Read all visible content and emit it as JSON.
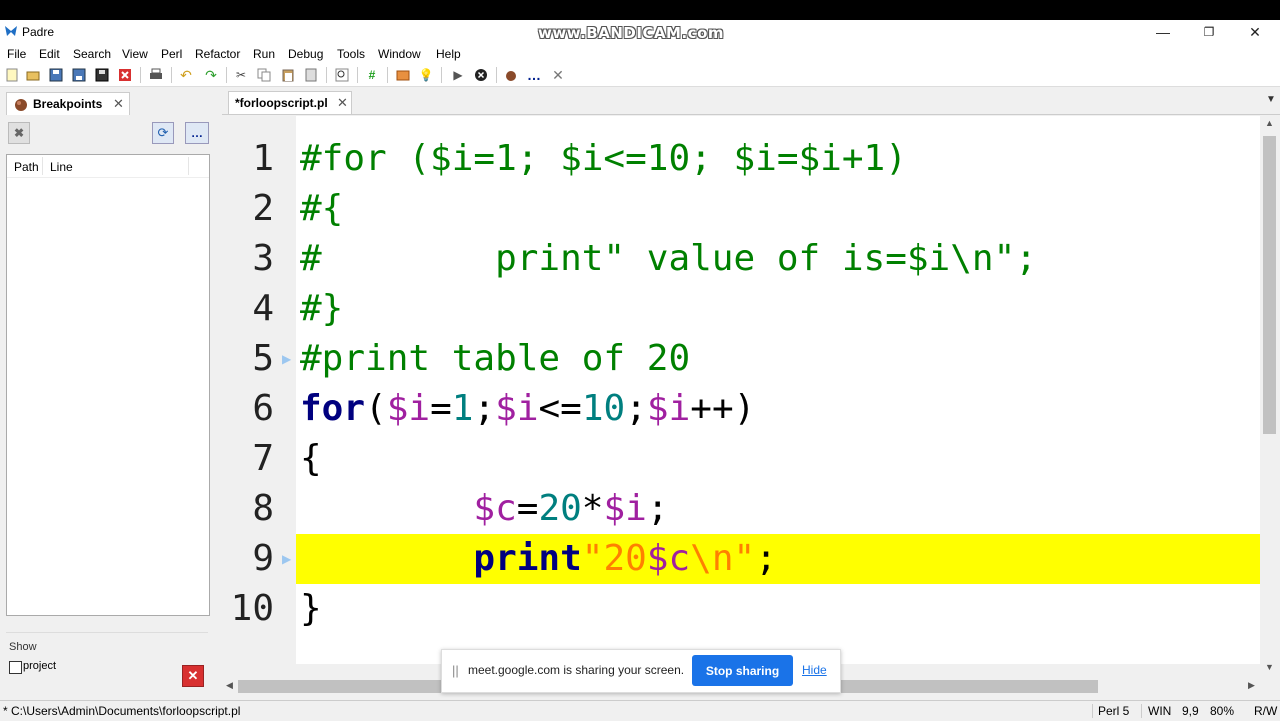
{
  "titlebar": {
    "title": "Padre",
    "minimize": "—",
    "restore": "❐",
    "close": "✕"
  },
  "watermark": "www.BANDICAM.com",
  "menu": [
    "File",
    "Edit",
    "Search",
    "View",
    "Perl",
    "Refactor",
    "Run",
    "Debug",
    "Tools",
    "Window",
    "Help"
  ],
  "left_panel": {
    "tab_label": "Breakpoints",
    "tab_close": "✕",
    "columns": [
      "Path",
      "Line"
    ],
    "show_label": "Show",
    "project_label": "project"
  },
  "editor": {
    "tab_label": "*forloopscript.pl",
    "tab_close": "✕",
    "line_numbers": [
      "1",
      "2",
      "3",
      "4",
      "5",
      "6",
      "7",
      "8",
      "9",
      "10"
    ],
    "lines": {
      "l1": "#for ($i=1; $i<=10; $i=$i+1)",
      "l2": "#{",
      "l3": "#        print\" value of is=$i\\n\";",
      "l4": "#}",
      "l5": "#print table of 20",
      "l6_for": "for",
      "l6_p1": "(",
      "l6_v1": "$i",
      "l6_eq": "=",
      "l6_n1": "1",
      "l6_sc1": ";",
      "l6_v2": "$i",
      "l6_le": "<=",
      "l6_n2": "10",
      "l6_sc2": ";",
      "l6_v3": "$i",
      "l6_inc": "++)",
      "l7": "{",
      "l8_ind": "        ",
      "l8_v1": "$c",
      "l8_eq": "=",
      "l8_n": "20",
      "l8_mul": "*",
      "l8_v2": "$i",
      "l8_sc": ";",
      "l9_ind": "        ",
      "l9_kw": "print",
      "l9_q1": "\"20",
      "l9_v": "$c",
      "l9_esc": "\\n",
      "l9_q2": "\"",
      "l9_sc": ";",
      "l10": "}"
    },
    "highlight_color": "#ffff00"
  },
  "share_bar": {
    "grip": "||",
    "message": "meet.google.com is sharing your screen.",
    "stop_label": "Stop sharing",
    "hide_label": "Hide"
  },
  "status": {
    "path": "* C:\\Users\\Admin\\Documents\\forloopscript.pl",
    "lang": "Perl 5",
    "eol": "WIN",
    "pos": "9,9",
    "zoom": "80%",
    "mode": "R/W"
  },
  "colors": {
    "comment": "#008000",
    "keyword": "#00007f",
    "variable": "#a020a0",
    "number": "#007f7f",
    "string": "#ff8000",
    "accent": "#1a73e8"
  }
}
